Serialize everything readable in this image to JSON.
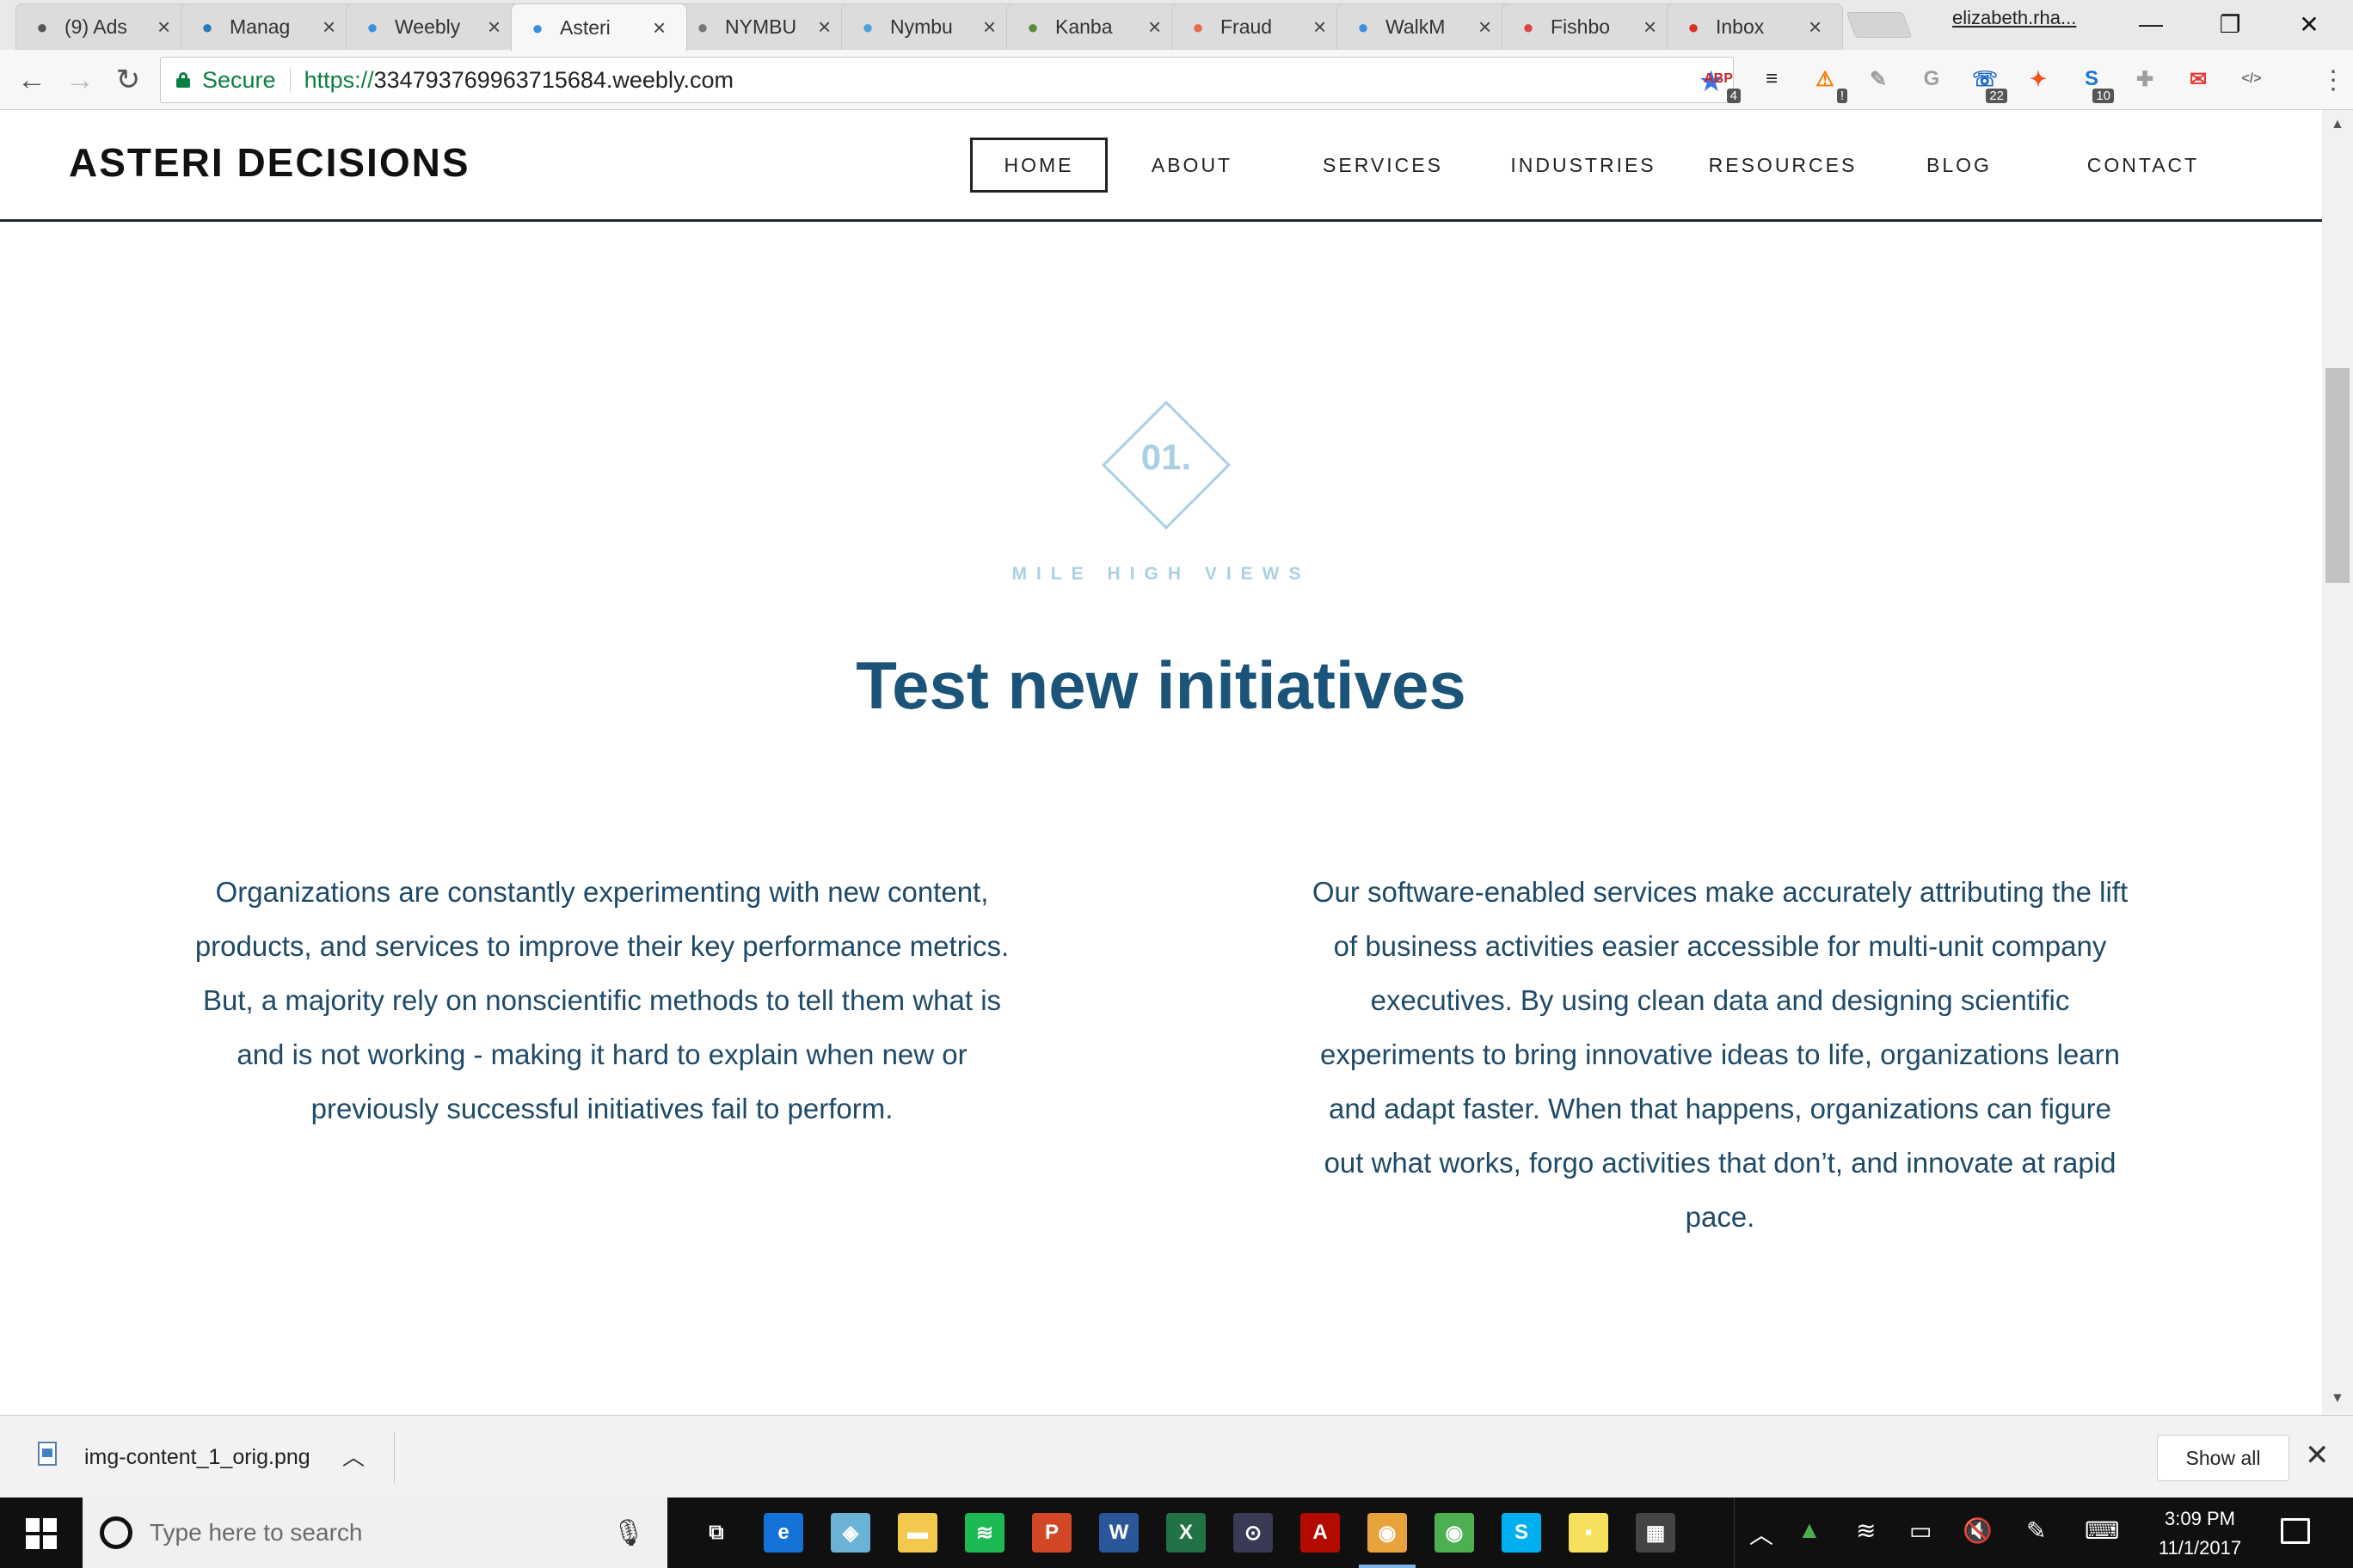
{
  "browser": {
    "tabs": [
      {
        "title": "(9) Ads",
        "icon": "ads-icon",
        "color": "#555555"
      },
      {
        "title": "Manag",
        "icon": "asterisk-icon",
        "color": "#2a7ab8"
      },
      {
        "title": "Weebly",
        "icon": "weebly-icon",
        "color": "#3b8fe0"
      },
      {
        "title": "Asteri",
        "icon": "weebly-icon",
        "color": "#3b8fe0",
        "active": true
      },
      {
        "title": "NYMBU",
        "icon": "document-icon",
        "color": "#777777"
      },
      {
        "title": "Nymbu",
        "icon": "nymbu-icon",
        "color": "#4aa3df"
      },
      {
        "title": "Kanba",
        "icon": "kanban-icon",
        "color": "#5a8a3a"
      },
      {
        "title": "Fraud",
        "icon": "fraud-icon",
        "color": "#e86a4a"
      },
      {
        "title": "WalkM",
        "icon": "walkme-icon",
        "color": "#3b8fe0"
      },
      {
        "title": "Fishbo",
        "icon": "fishbone-icon",
        "color": "#e04545"
      },
      {
        "title": "Inbox",
        "icon": "gmail-icon",
        "color": "#d93025"
      }
    ],
    "profile_name": "elizabeth.rha...",
    "url_secure_label": "Secure",
    "url_scheme": "https://",
    "url_host": "334793769963715684.weebly.com",
    "extensions": [
      {
        "name": "adblock-icon",
        "glyph": "ABP",
        "badge": "4",
        "color": "#c62828"
      },
      {
        "name": "buffer-icon",
        "glyph": "≡",
        "badge": "",
        "color": "#222222"
      },
      {
        "name": "hubspot-icon",
        "glyph": "⚠",
        "badge": "!",
        "color": "#f57c00"
      },
      {
        "name": "pdf-icon",
        "glyph": "✎",
        "badge": "",
        "color": "#9e9e9e"
      },
      {
        "name": "grammarly-icon",
        "glyph": "G",
        "badge": "",
        "color": "#9e9e9e"
      },
      {
        "name": "phone-icon",
        "glyph": "☏",
        "badge": "22",
        "color": "#1565c0"
      },
      {
        "name": "fox-icon",
        "glyph": "✦",
        "badge": "",
        "color": "#f4511e"
      },
      {
        "name": "skype-ext-icon",
        "glyph": "S",
        "badge": "10",
        "color": "#1976d2"
      },
      {
        "name": "puzzle-icon",
        "glyph": "✚",
        "badge": "",
        "color": "#9e9e9e"
      },
      {
        "name": "boomerang-icon",
        "glyph": "✉",
        "badge": "",
        "color": "#e53935"
      },
      {
        "name": "code-icon",
        "glyph": "</>",
        "badge": "",
        "color": "#757575"
      }
    ]
  },
  "site": {
    "logo": "ASTERI DECISIONS",
    "nav": [
      {
        "label": "HOME",
        "active": true
      },
      {
        "label": "ABOUT"
      },
      {
        "label": "SERVICES"
      },
      {
        "label": "INDUSTRIES"
      },
      {
        "label": "RESOURCES"
      },
      {
        "label": "BLOG"
      },
      {
        "label": "CONTACT"
      }
    ],
    "section": {
      "number": "01.",
      "kicker": "MILE HIGH VIEWS",
      "headline": "Test new initiatives",
      "col_left": "Organizations are constantly experimenting with new content, products, and services to improve their key performance metrics. But, a majority rely on nonscientific methods to tell them what is and is not working - making it hard to explain when new or previously successful initiatives fail to perform.",
      "col_right": "Our software-enabled services make accurately attributing the lift of business activities easier accessible for multi-unit company executives. By using clean data and designing scientific experiments to bring innovative ideas to life, organizations learn and adapt faster. When that happens, organizations can figure out what works, forgo activities that don’t, and innovate at rapid pace."
    },
    "colors": {
      "heading": "#1b5478",
      "body": "#1e4a68",
      "accent": "#a9d0e4"
    }
  },
  "downloads": {
    "filename": "img-content_1_orig.png",
    "show_all": "Show all"
  },
  "taskbar": {
    "search_placeholder": "Type here to search",
    "apps": [
      {
        "name": "task-view-icon",
        "glyph": "⧉",
        "color": "#101010"
      },
      {
        "name": "edge-icon",
        "glyph": "e",
        "color": "#1572d6"
      },
      {
        "name": "mail-app-icon",
        "glyph": "◈",
        "color": "#6bb3d6"
      },
      {
        "name": "file-explorer-icon",
        "glyph": "▬",
        "color": "#f2c94c"
      },
      {
        "name": "spotify-icon",
        "glyph": "≋",
        "color": "#1db954"
      },
      {
        "name": "powerpoint-icon",
        "glyph": "P",
        "color": "#d24726"
      },
      {
        "name": "word-icon",
        "glyph": "W",
        "color": "#2b579a"
      },
      {
        "name": "excel-icon",
        "glyph": "X",
        "color": "#217346"
      },
      {
        "name": "vpn-icon",
        "glyph": "⊙",
        "color": "#3a3a55"
      },
      {
        "name": "acrobat-icon",
        "glyph": "A",
        "color": "#b30b00"
      },
      {
        "name": "chrome-canary-icon",
        "glyph": "◉",
        "color": "#e8a33c"
      },
      {
        "name": "chrome-icon",
        "glyph": "◉",
        "color": "#4caf50"
      },
      {
        "name": "skype-icon",
        "glyph": "S",
        "color": "#00aff0"
      },
      {
        "name": "sticky-notes-icon",
        "glyph": "▪",
        "color": "#f6e05e"
      },
      {
        "name": "calculator-icon",
        "glyph": "▦",
        "color": "#444444"
      }
    ],
    "time": "3:09 PM",
    "date": "11/1/2017"
  }
}
